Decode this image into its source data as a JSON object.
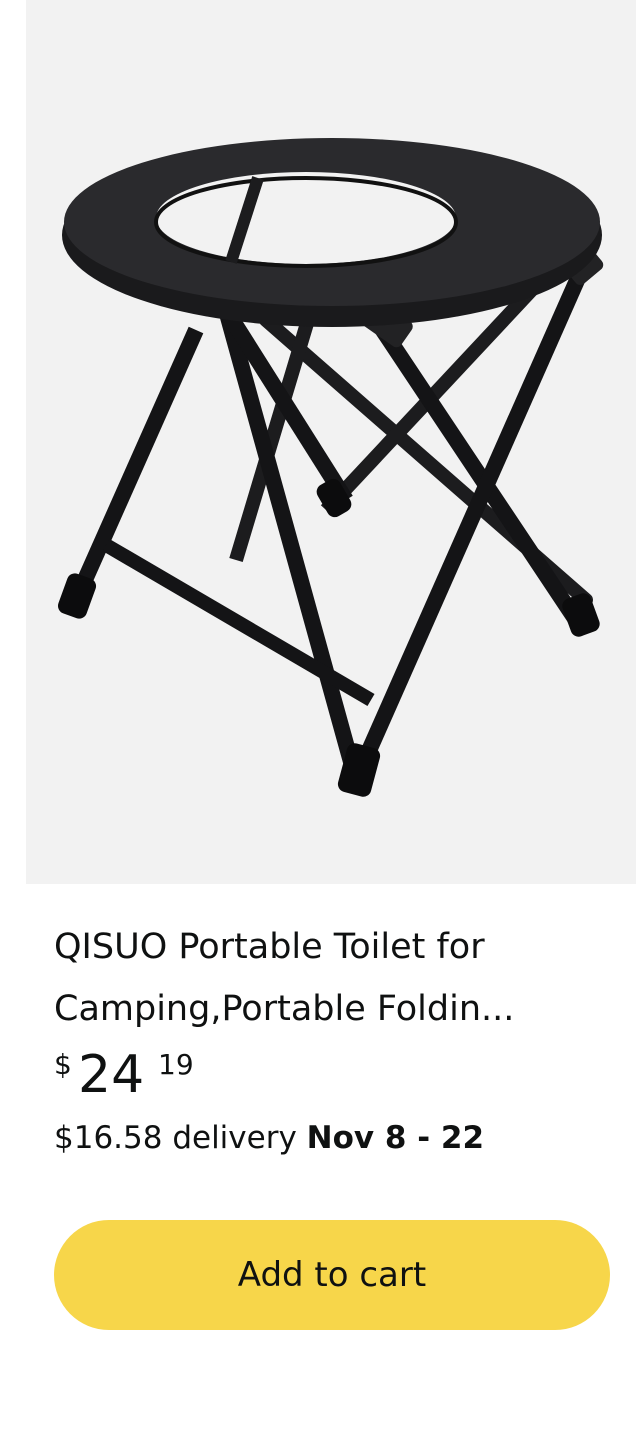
{
  "product": {
    "title_line1": "QISUO Portable Toilet for",
    "title_line2": "Camping,Portable Foldin...",
    "price_symbol": "$",
    "price_whole": "24",
    "price_fraction": "19",
    "delivery_price": "$16.58 delivery",
    "delivery_date": "Nov 8 - 22",
    "add_to_cart_label": "Add to cart"
  },
  "colors": {
    "button": "#f7d64a",
    "text": "#0f1111",
    "image_bg": "#f2f2f2"
  }
}
